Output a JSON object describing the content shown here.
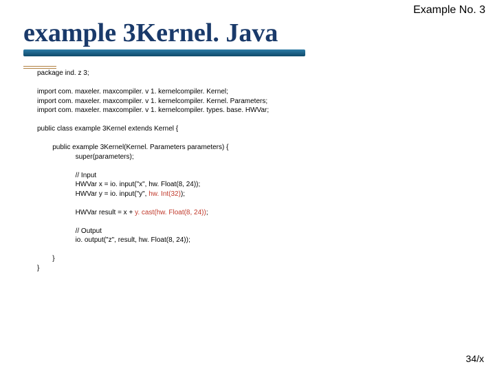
{
  "header": {
    "label": "Example No. 3"
  },
  "title": {
    "text": "example 3Kernel. Java"
  },
  "code": {
    "package": "package ind. z 3;",
    "import1": "import com. maxeler. maxcompiler. v 1. kernelcompiler. Kernel;",
    "import2": "import com. maxeler. maxcompiler. v 1. kernelcompiler. Kernel. Parameters;",
    "import3": "import com. maxeler. maxcompiler. v 1. kernelcompiler. types. base. HWVar;",
    "class_decl": "public class example 3Kernel extends Kernel {",
    "ctor_decl": "public example 3Kernel(Kernel. Parameters parameters) {",
    "super_call": "super(parameters);",
    "cmt_input": "// Input",
    "line_x": "HWVar x = io. input(\"x\", hw. Float(8, 24));",
    "line_y_a": "HWVar y = io. input(\"y\", ",
    "line_y_b": "hw. Int(32)",
    "line_y_c": ");",
    "line_res_a": "HWVar result = x + ",
    "line_res_b": "y. cast(hw. Float(8, 24))",
    "line_res_c": ";",
    "cmt_output": "// Output",
    "line_out": "io. output(\"z\", result, hw. Float(8, 24));",
    "brace1": "}",
    "brace2": "}"
  },
  "footer": {
    "page": "34/x"
  }
}
